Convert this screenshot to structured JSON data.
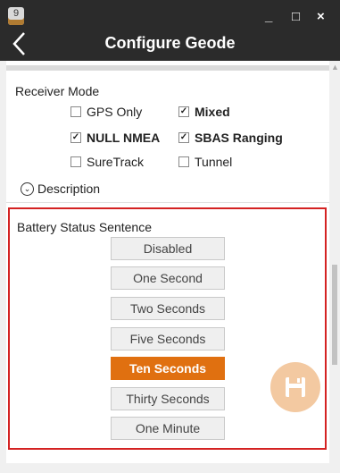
{
  "window": {
    "icon_label": "9",
    "minimize_glyph": "_",
    "maximize_glyph": "□",
    "close_glyph": "×",
    "title": "Configure Geode",
    "back_icon": "chevron-left-icon"
  },
  "receiver_mode": {
    "label": "Receiver Mode",
    "options": [
      {
        "label": "GPS Only",
        "checked": false
      },
      {
        "label": "Mixed",
        "checked": true
      },
      {
        "label": "NULL NMEA",
        "checked": true
      },
      {
        "label": "SBAS Ranging",
        "checked": true
      },
      {
        "label": "SureTrack",
        "checked": false
      },
      {
        "label": "Tunnel",
        "checked": false
      }
    ],
    "description_label": "Description"
  },
  "battery_status": {
    "label": "Battery Status Sentence",
    "options": [
      {
        "label": "Disabled",
        "selected": false
      },
      {
        "label": "One Second",
        "selected": false
      },
      {
        "label": "Two Seconds",
        "selected": false
      },
      {
        "label": "Five Seconds",
        "selected": false
      },
      {
        "label": "Ten Seconds",
        "selected": true
      },
      {
        "label": "Thirty Seconds",
        "selected": false
      },
      {
        "label": "One Minute",
        "selected": false
      }
    ]
  },
  "colors": {
    "titlebar": "#2b2b2b",
    "accent": "#e07010",
    "highlight_border": "#d42222",
    "save_fab": "#f3c9a1"
  },
  "save_icon": "floppy-disk-icon"
}
